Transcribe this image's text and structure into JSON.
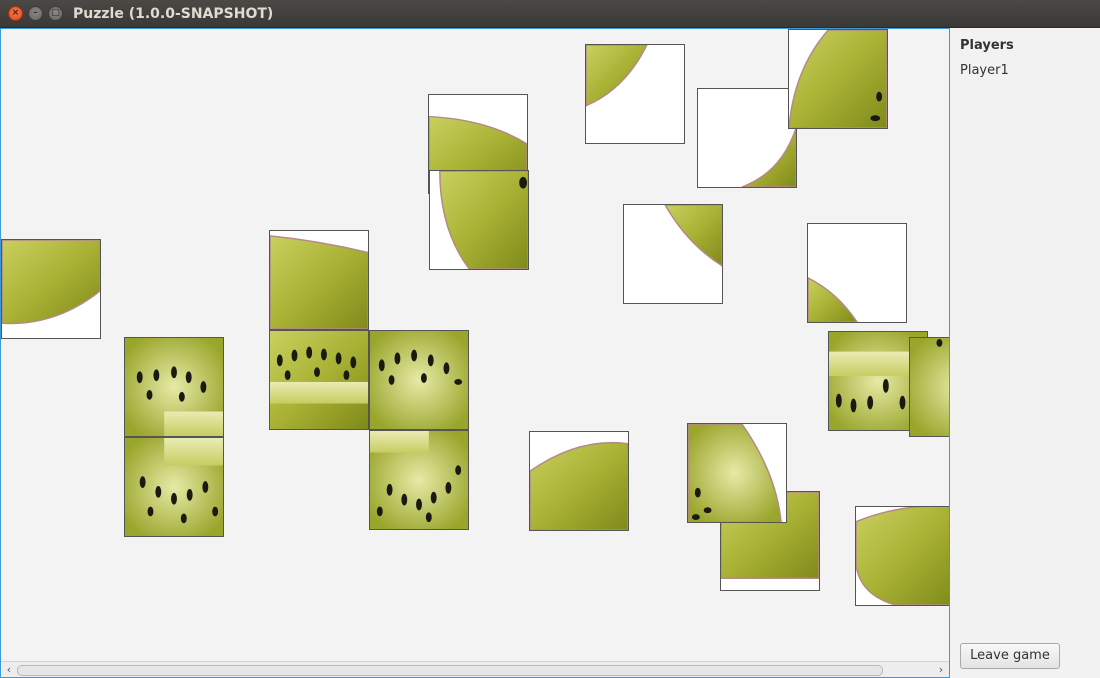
{
  "window": {
    "title": "Puzzle (1.0.0-SNAPSHOT)",
    "close_glyph": "×",
    "min_glyph": "–",
    "max_glyph": "□"
  },
  "sidebar": {
    "players_heading": "Players",
    "players": [
      "Player1"
    ],
    "leave_button": "Leave game"
  },
  "scrollbar": {
    "left_glyph": "‹",
    "right_glyph": "›"
  },
  "colors": {
    "kiwi_green": "#9aa82a",
    "kiwi_light": "#d6dc8a",
    "seed": "#1a1a12",
    "board_border": "#3a9bd8"
  }
}
